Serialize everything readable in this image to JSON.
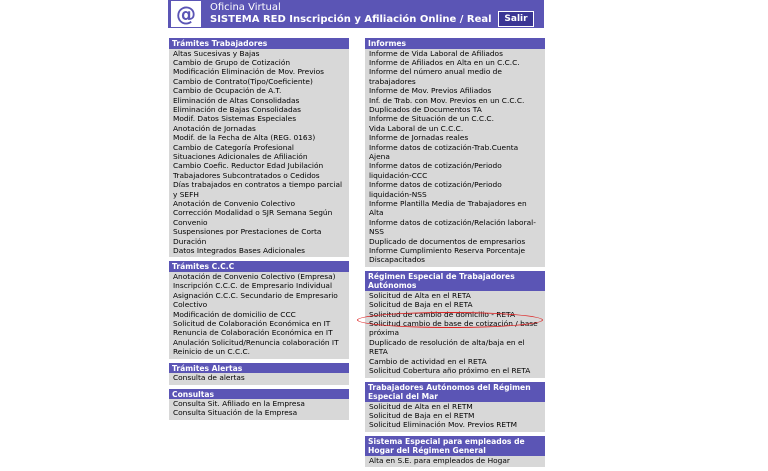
{
  "header": {
    "logo_text": "@",
    "title_line1": "Oficina Virtual",
    "title_line2": "SISTEMA RED Inscripción y Afiliación Online / Real",
    "exit_button": "Salir",
    "accent_color": "#5b55b5"
  },
  "left_sections": [
    {
      "title": "Trámites Trabajadores",
      "items": [
        "Altas Sucesivas y Bajas",
        "Cambio de Grupo de Cotización",
        "Modificación Eliminación de Mov. Previos",
        "Cambio de Contrato(Tipo/Coeficiente)",
        "Cambio de Ocupación de A.T.",
        "Eliminación de Altas Consolidadas",
        "Eliminación de Bajas Consolidadas",
        "Modif. Datos Sistemas Especiales",
        "Anotación de Jornadas",
        "Modif. de la Fecha de Alta (REG. 0163)",
        "Cambio de Categoría Profesional",
        "Situaciones Adicionales de Afiliación",
        "Cambio Coefic. Reductor Edad Jubilación",
        "Trabajadores Subcontratados o Cedidos",
        "Días trabajados en contratos a tiempo parcial y SEFH",
        "Anotación de Convenio Colectivo",
        "Corrección Modalidad o SJR Semana Según Convenio",
        "Suspensiones por Prestaciones de Corta Duración",
        "Datos Integrados Bases Adicionales"
      ]
    },
    {
      "title": "Trámites C.C.C",
      "items": [
        "Anotación de Convenio Colectivo (Empresa)",
        "Inscripción C.C.C. de Empresario Individual",
        "Asignación C.C.C. Secundario de Empresario Colectivo",
        "Modificación de domicilio de CCC",
        "Solicitud de Colaboración Económica en IT",
        "Renuncia de Colaboración Económica en IT",
        "Anulación Solicitud/Renuncia colaboración IT",
        "Reinicio de un C.C.C."
      ]
    },
    {
      "title": "Trámites Alertas",
      "items": [
        "Consulta de alertas"
      ]
    },
    {
      "title": "Consultas",
      "items": [
        "Consulta Sit. Afiliado en la Empresa",
        "Consulta Situación de la Empresa"
      ]
    }
  ],
  "right_sections": [
    {
      "title": "Informes",
      "items": [
        "Informe de Vida Laboral de Afiliados",
        "Informe de Afiliados en Alta en un C.C.C.",
        "Informe del número anual medio de trabajadores",
        "Informe de Mov. Previos Afiliados",
        "Inf. de Trab. con Mov. Previos en un C.C.C.",
        "Duplicados de Documentos TA",
        "Informe de Situación de un C.C.C.",
        "Vida Laboral de un C.C.C.",
        "Informe de Jornadas reales",
        "Informe datos de cotización-Trab.Cuenta Ajena",
        "Informe datos de cotización/Periodo liquidación-CCC",
        "Informe datos de cotización/Periodo liquidación-NSS",
        "Informe Plantilla Media de Trabajadores en Alta",
        "Informe datos de cotización/Relación laboral-NSS",
        "Duplicado de documentos de empresarios",
        "Informe Cumplimiento Reserva Porcentaje Discapacitados"
      ]
    },
    {
      "title": "Régimen Especial de Trabajadores Autónomos",
      "items": [
        "Solicitud de Alta en el RETA",
        "Solicitud de Baja en el RETA",
        "Solicitud de cambio de domicilio - RETA",
        "Solicitud cambio de base de cotización / base próxima",
        "Duplicado de resolución de alta/baja en el RETA",
        "Cambio de actividad en el RETA",
        "Solicitud Cobertura año próximo en el RETA"
      ]
    },
    {
      "title": "Trabajadores Autónomos del Régimen Especial del Mar",
      "items": [
        "Solicitud de Alta en el RETM",
        "Solicitud de Baja en el RETM",
        "Solicitud Eliminación Mov. Previos RETM"
      ]
    },
    {
      "title": "Sistema Especial para empleados de Hogar del Régimen General",
      "items": [
        "Alta en S.E. para empleados de Hogar"
      ]
    }
  ]
}
